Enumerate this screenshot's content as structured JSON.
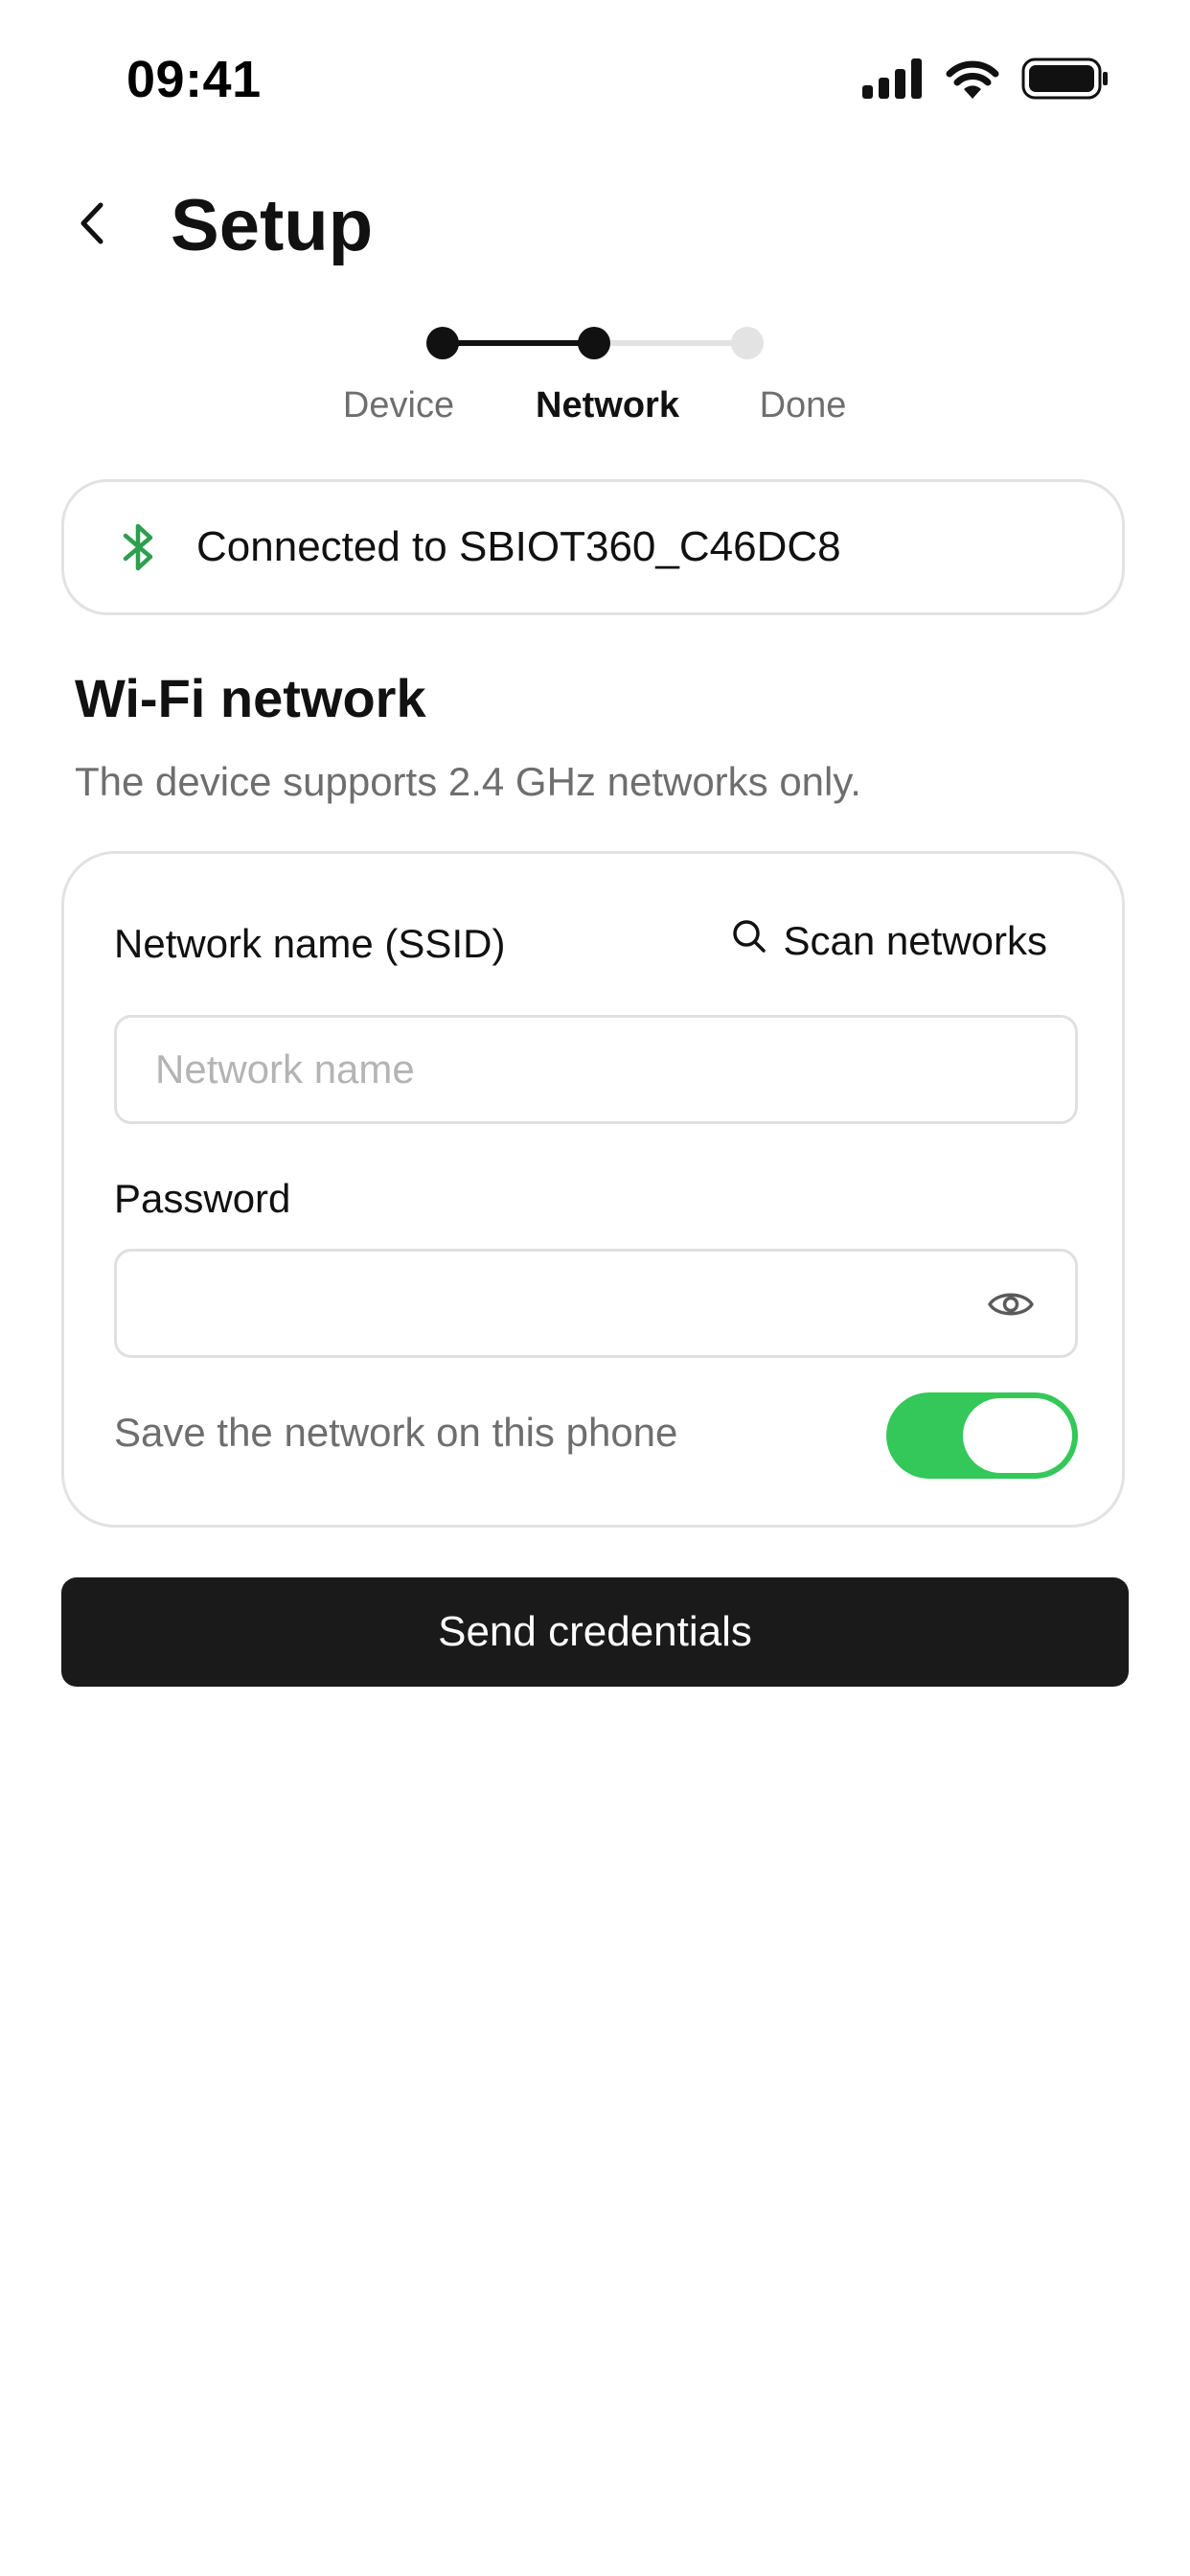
{
  "status_bar": {
    "time": "09:41",
    "icons": [
      "cellular-signal-icon",
      "wifi-icon",
      "battery-icon"
    ]
  },
  "header": {
    "title": "Setup",
    "back_icon": "chevron-left-icon"
  },
  "stepper": {
    "steps": [
      {
        "label": "Device",
        "state": "completed"
      },
      {
        "label": "Network",
        "state": "active"
      },
      {
        "label": "Done",
        "state": "upcoming"
      }
    ]
  },
  "connection": {
    "icon": "bluetooth-icon",
    "text": "Connected to SBIOT360_C46DC8"
  },
  "wifi_section": {
    "title": "Wi-Fi network",
    "subtitle": "The device supports 2.4 GHz networks only."
  },
  "form": {
    "ssid_label": "Network name (SSID)",
    "scan_label": "Scan networks",
    "scan_icon": "search-icon",
    "ssid_value": "",
    "ssid_placeholder": "Network name",
    "password_label": "Password",
    "password_value": "",
    "show_password_icon": "eye-icon",
    "save_network_label": "Save the network on this phone",
    "save_network_enabled": true
  },
  "actions": {
    "send_label": "Send credentials"
  },
  "colors": {
    "toggle_on": "#34c759",
    "bluetooth": "#2e9e4f",
    "primary_button": "#1a1a1a",
    "step_inactive": "#e3e3e3"
  }
}
